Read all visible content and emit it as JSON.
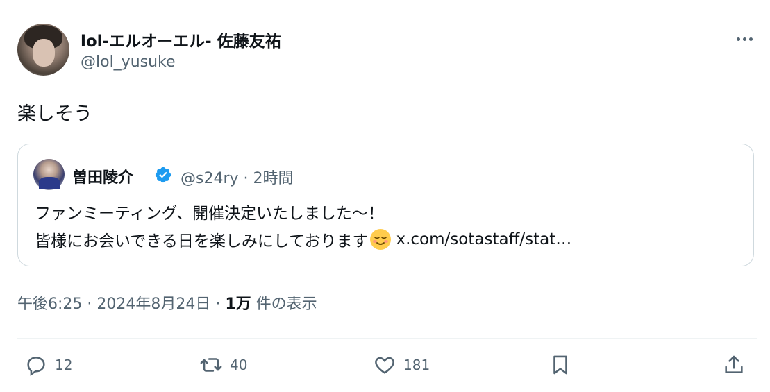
{
  "author": {
    "display_name": "lol-エルオーエル- 佐藤友祐",
    "handle": "@lol_yusuke"
  },
  "tweet": {
    "text": "楽しそう"
  },
  "quoted": {
    "display_name": "曽田陵介",
    "verified": true,
    "meta": "@s24ry · 2時間",
    "line1": "ファンミーティング、開催決定いたしました〜！",
    "line2_text": "皆様にお会いできる日を楽しみにしております",
    "emoji": "relieved-face-icon",
    "link": "x.com/sotastaff/stat…"
  },
  "meta": {
    "timestamp": "午後6:25 · 2024年8月24日 · ",
    "views_count": "1万",
    "views_label": " 件の表示"
  },
  "actions": {
    "replies": "12",
    "retweets": "40",
    "likes": "181"
  },
  "colors": {
    "secondary_text": "#536471",
    "border": "#cfd9de",
    "verified_blue": "#1d9bf0"
  }
}
